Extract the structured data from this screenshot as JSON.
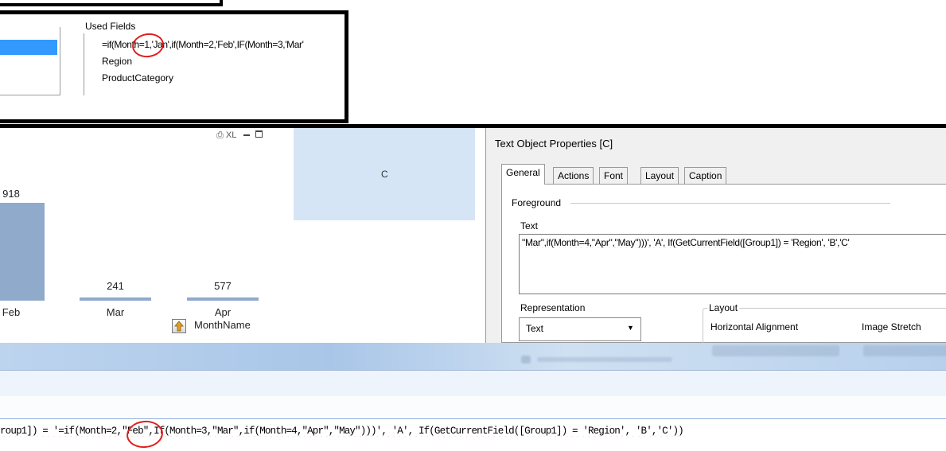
{
  "group_panel": {
    "used_fields_label": "Used Fields",
    "used_fields": [
      "=if(Month=1,'Jan',if(Month=2,'Feb',IF(Month=3,'Mar'",
      "Region",
      "ProductCategory"
    ]
  },
  "chart": {
    "toolbar_icons": "⎙ XL",
    "dimension_label": "MonthName",
    "bar_color": "#8faacb"
  },
  "chart_data": {
    "type": "bar",
    "categories": [
      "Feb",
      "Mar",
      "Apr"
    ],
    "values": [
      918,
      241,
      577
    ],
    "data_labels": [
      "918",
      "241",
      "577"
    ],
    "xlabel": "MonthName",
    "ylabel": ""
  },
  "text_object": {
    "label": "C",
    "color": "#d6e5f5"
  },
  "dialog": {
    "title": "Text Object Properties [C]",
    "tabs": [
      "General",
      "Actions",
      "Font",
      "Layout",
      "Caption"
    ],
    "active_tab": "General",
    "foreground_label": "Foreground",
    "text_label": "Text",
    "text_value": "\"Mar\",if(Month=4,\"Apr\",\"May\")))', 'A', If(GetCurrentField([Group1]) = 'Region', 'B','C'",
    "representation_label": "Representation",
    "representation_value": "Text",
    "layout_label": "Layout",
    "horizontal_alignment_label": "Horizontal Alignment",
    "image_stretch_label": "Image Stretch"
  },
  "editor": {
    "expression": "roup1]) = '=if(Month=2,\"Feb\",If(Month=3,\"Mar\",if(Month=4,\"Apr\",\"May\")))', 'A', If(GetCurrentField([Group1]) = 'Region', 'B','C'))"
  },
  "colors": {
    "annotation": "#e11d1d",
    "selection": "#3399ff"
  }
}
